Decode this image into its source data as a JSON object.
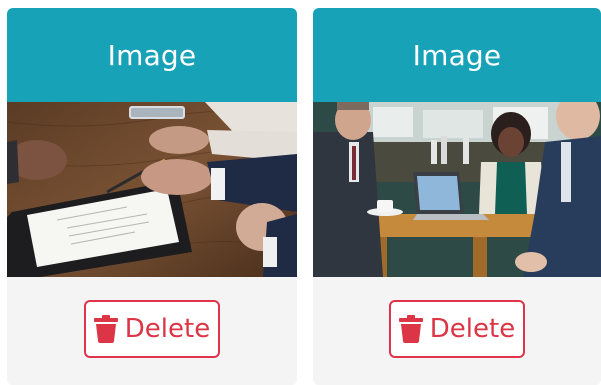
{
  "cards": [
    {
      "header": "Image",
      "image_icon": "business-contract-signing-photo",
      "delete_label": "Delete",
      "delete_icon": "trash-icon"
    },
    {
      "header": "Image",
      "image_icon": "business-meeting-cafe-photo",
      "delete_label": "Delete",
      "delete_icon": "trash-icon"
    }
  ],
  "colors": {
    "header_bg": "#18a2b8",
    "header_text": "#ffffff",
    "card_body_bg": "#f4f4f4",
    "danger": "#dc3545"
  }
}
